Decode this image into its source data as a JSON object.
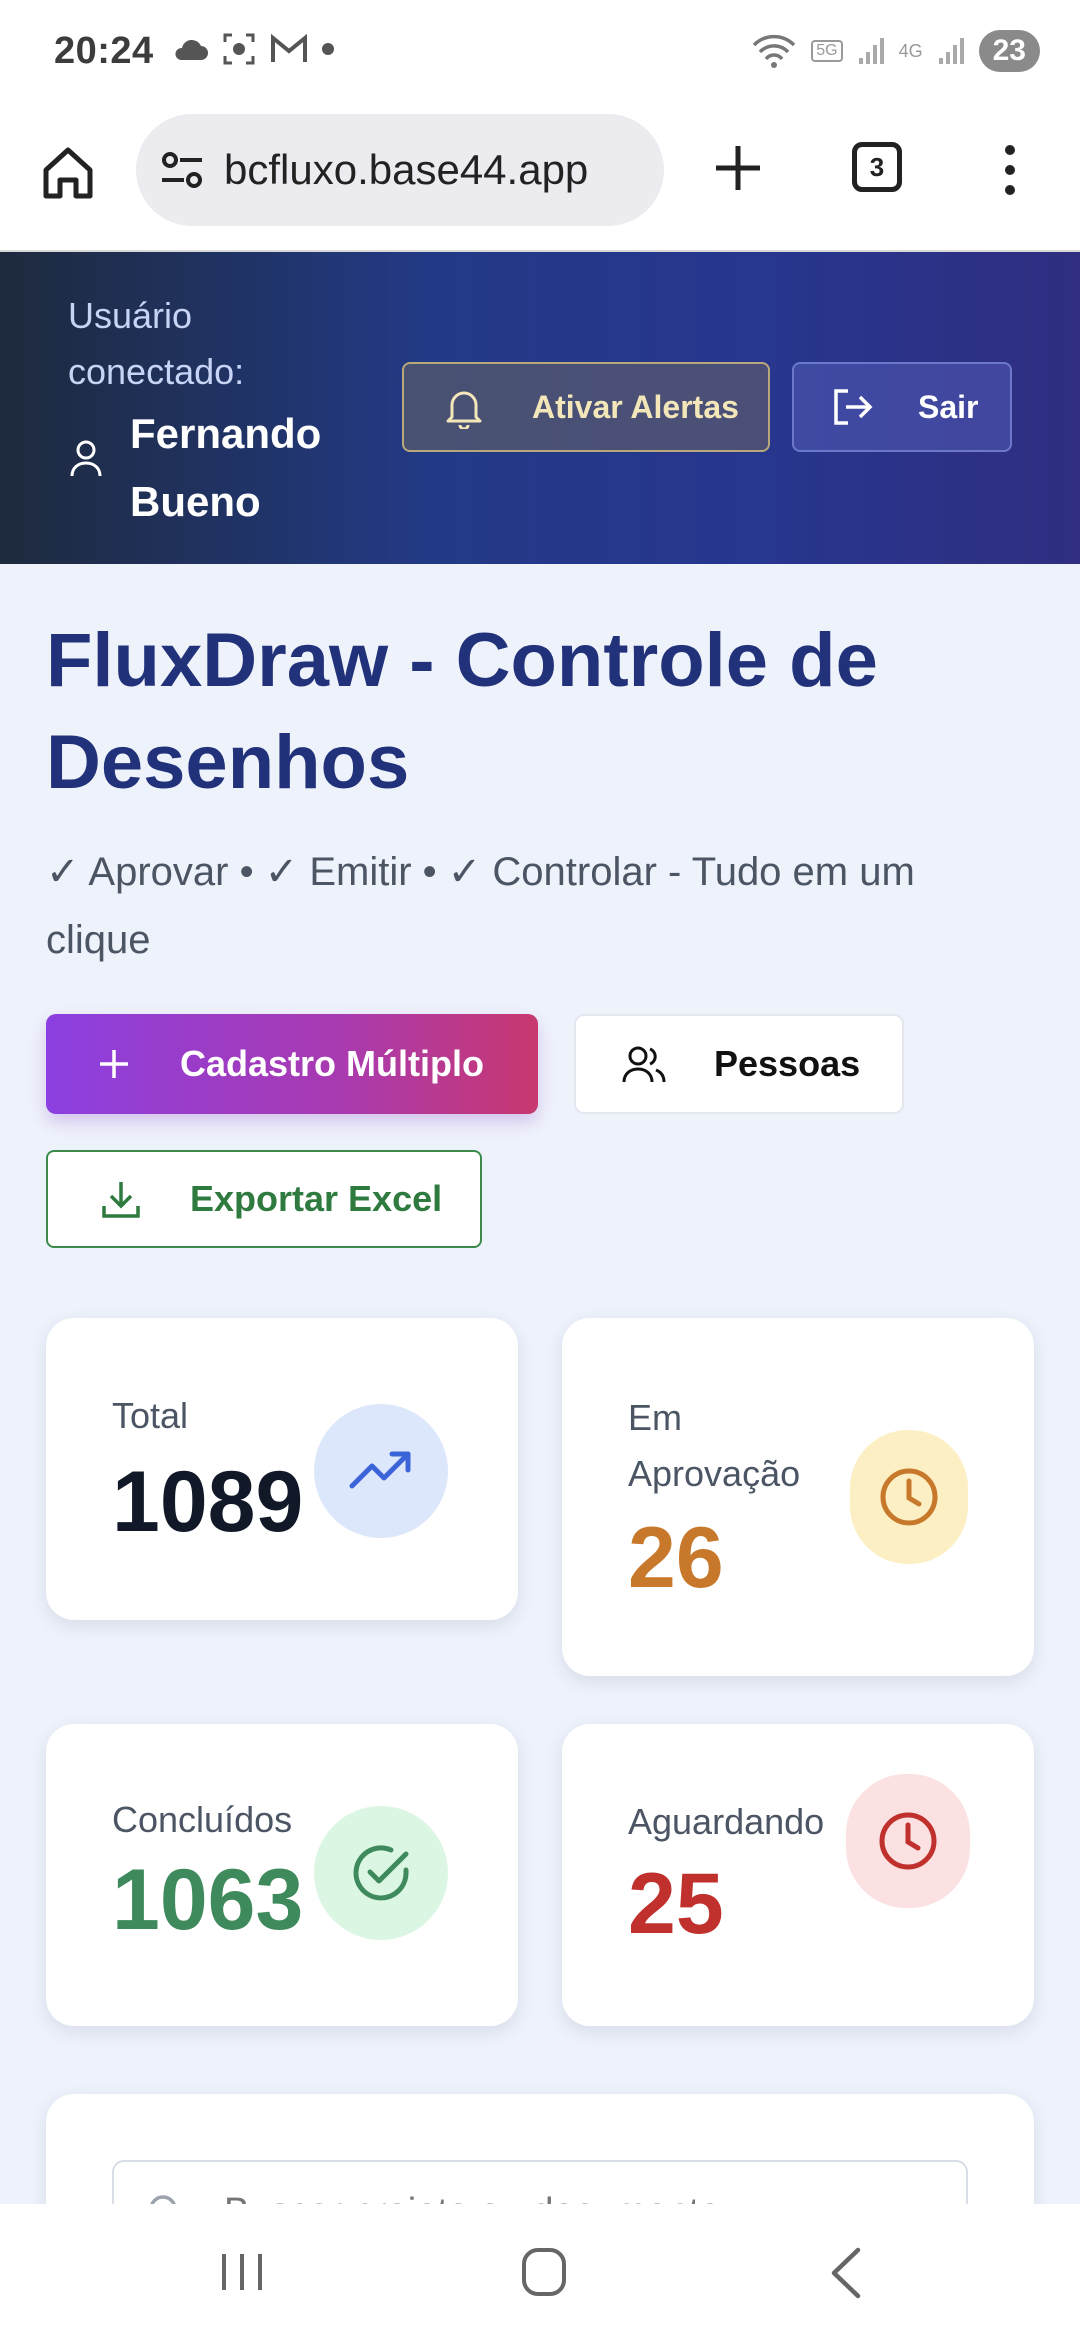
{
  "status_bar": {
    "time": "20:24",
    "network_5g": "5G",
    "network_4g": "4G",
    "battery": "23",
    "icons": [
      "cloud-icon",
      "screenshot-icon",
      "gmail-icon",
      "notification-dot",
      "wifi-icon",
      "signal-icon",
      "signal-icon",
      "battery-icon"
    ]
  },
  "browser": {
    "url": "bcfluxo.base44.app",
    "tab_count": "3"
  },
  "header": {
    "user_label": "Usuário conectado:",
    "user_name": "Fernando Bueno",
    "alert_button": "Ativar Alertas",
    "exit_button": "Sair"
  },
  "main": {
    "title": "FluxDraw - Controle de Desenhos",
    "subtitle": "✓ Aprovar • ✓ Emitir • ✓ Controlar - Tudo em um clique",
    "btn_cadastro": "Cadastro Múltiplo",
    "btn_pessoas": "Pessoas",
    "btn_exportar": "Exportar Excel"
  },
  "stats": {
    "total": {
      "label": "Total",
      "value": "1089"
    },
    "em_aprovacao": {
      "label": "Em Aprovação",
      "value": "26"
    },
    "concluidos": {
      "label": "Concluídos",
      "value": "1063"
    },
    "aguardando": {
      "label": "Aguardando",
      "value": "25"
    }
  },
  "search": {
    "placeholder": "Buscar projeto ou documento..."
  },
  "colors": {
    "accent": "#22327a",
    "total": "#111827",
    "em_aprovacao": "#c8782a",
    "concluidos": "#3e8a5c",
    "aguardando": "#c0302c"
  }
}
